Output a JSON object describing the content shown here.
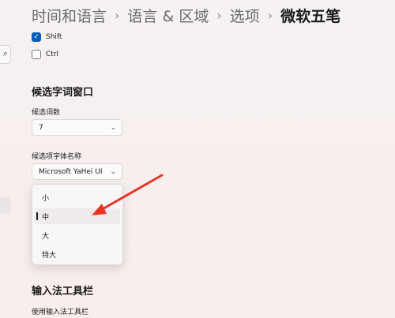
{
  "breadcrumb": {
    "items": [
      "时间和语言",
      "语言 & 区域",
      "选项"
    ],
    "current": "微软五笔",
    "separator": "›"
  },
  "modifiers": {
    "shift": {
      "label": "Shift",
      "checked": true,
      "check_glyph": "✓"
    },
    "ctrl": {
      "label": "Ctrl",
      "checked": false
    }
  },
  "candidate_window": {
    "title": "候选字词窗口",
    "count_label": "候选词数",
    "count_value": "7",
    "font_label": "候选项字体名称",
    "font_value": "Microsoft YaHei UI",
    "size_options": [
      "小",
      "中",
      "大",
      "特大"
    ],
    "selected_option": "中"
  },
  "toolbar": {
    "title": "输入法工具栏",
    "use_label": "使用输入法工具栏"
  },
  "icons": {
    "search": "⌕",
    "chevron": "⌄"
  },
  "colors": {
    "accent": "#005fb8",
    "annotation_arrow": "#e8352a"
  }
}
